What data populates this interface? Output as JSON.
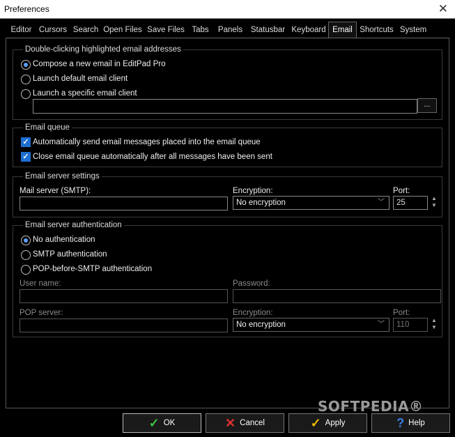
{
  "window": {
    "title": "Preferences",
    "close_glyph": "✕"
  },
  "tabs": [
    {
      "label": "Editor"
    },
    {
      "label": "Cursors"
    },
    {
      "label": "Search"
    },
    {
      "label": "Open Files"
    },
    {
      "label": "Save Files"
    },
    {
      "label": "Tabs"
    },
    {
      "label": "Panels"
    },
    {
      "label": "Statusbar"
    },
    {
      "label": "Keyboard"
    },
    {
      "label": "Email",
      "active": true
    },
    {
      "label": "Shortcuts"
    },
    {
      "label": "System"
    }
  ],
  "double_click": {
    "legend": "Double-clicking highlighted email addresses",
    "options": [
      {
        "label": "Compose a new email in EditPad Pro",
        "selected": true
      },
      {
        "label": "Launch default email client",
        "selected": false
      },
      {
        "label": "Launch a specific email client",
        "selected": false
      }
    ],
    "client_path": "",
    "browse_label": "..."
  },
  "queue": {
    "legend": "Email queue",
    "options": [
      {
        "label": "Automatically send email messages placed into the email queue",
        "checked": true
      },
      {
        "label": "Close email queue automatically after all messages have been sent",
        "checked": true
      }
    ]
  },
  "server": {
    "legend": "Email server settings",
    "mail_server_label": "Mail server (SMTP):",
    "mail_server_value": "",
    "encryption_label": "Encryption:",
    "encryption_value": "No encryption",
    "port_label": "Port:",
    "port_value": "25"
  },
  "auth": {
    "legend": "Email server authentication",
    "options": [
      {
        "label": "No authentication",
        "selected": true
      },
      {
        "label": "SMTP authentication",
        "selected": false
      },
      {
        "label": "POP-before-SMTP authentication",
        "selected": false
      }
    ],
    "username_label": "User name:",
    "password_label": "Password:",
    "pop_server_label": "POP server:",
    "encryption_label": "Encryption:",
    "encryption_value": "No encryption",
    "port_label": "Port:",
    "port_value": "110"
  },
  "buttons": {
    "ok": "OK",
    "cancel": "Cancel",
    "apply": "Apply",
    "help": "Help"
  },
  "icons": {
    "ok": "check-icon",
    "cancel": "x-icon",
    "apply": "check-icon",
    "help": "question-icon"
  },
  "colors": {
    "ok_icon": "#3cc23c",
    "cancel_icon": "#e03030",
    "apply_icon": "#f0b800",
    "help_icon": "#3a7fe0",
    "accent": "#1e6fd0"
  },
  "watermark": "SOFTPEDIA®"
}
